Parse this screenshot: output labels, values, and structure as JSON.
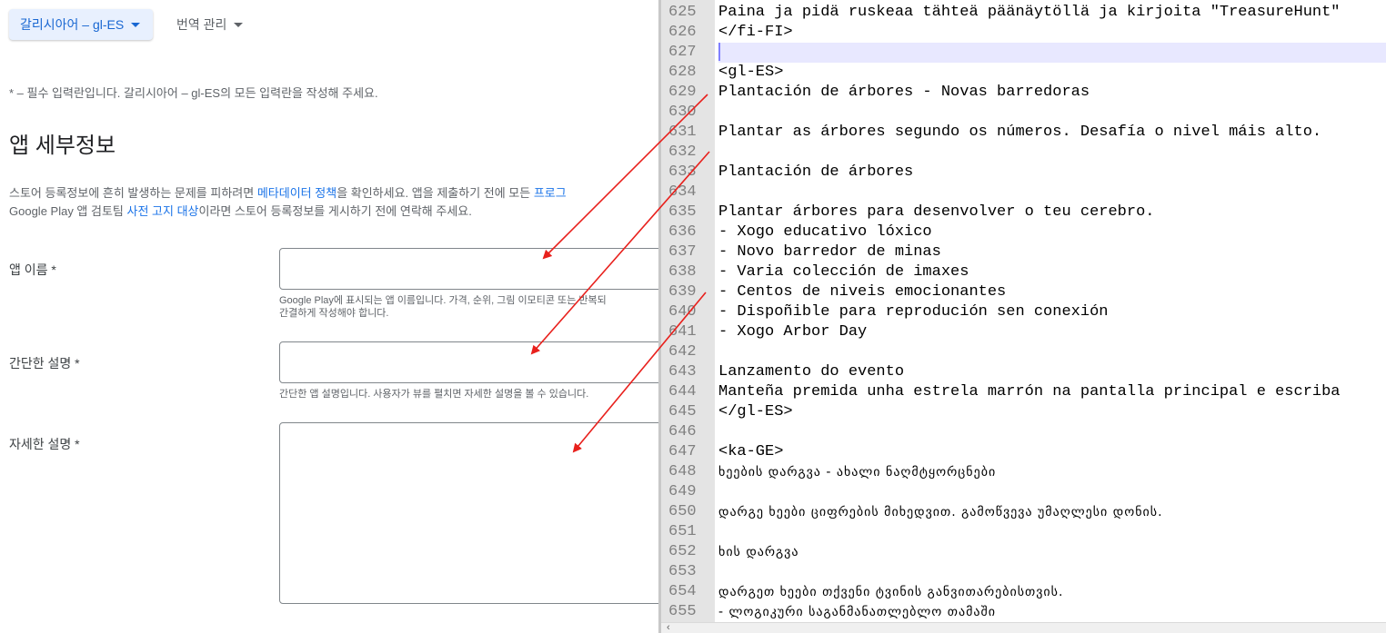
{
  "header": {
    "language_chip": "갈리시아어 – gl-ES",
    "translation_menu": "번역 관리"
  },
  "required_note": "* – 필수 입력란입니다. 갈리시아어 – gl-ES의 모든 입력란을 작성해 주세요.",
  "section_title": "앱 세부정보",
  "policy": {
    "line1_pre": "스토어 등록정보에 흔히 발생하는 문제를 피하려면 ",
    "line1_link1": "메타데이터 정책",
    "line1_mid": "을 확인하세요. 앱을 제출하기 전에 모든 ",
    "line1_link2": "프로그",
    "line2_pre": "Google Play 앱 검토팀 ",
    "line2_link": "사전 고지 대상",
    "line2_post": "이라면 스토어 등록정보를 게시하기 전에 연락해 주세요."
  },
  "fields": {
    "app_name": {
      "label": "앱 이름 *",
      "value": "",
      "help_line1": "Google Play에 표시되는 앱 이름입니다. 가격, 순위, 그림 이모티콘 또는 반복되",
      "help_line2": "간결하게 작성해야 합니다."
    },
    "short_desc": {
      "label": "간단한 설명 *",
      "value": "",
      "help_line1": "간단한 앱 설명입니다. 사용자가 뷰를 펼치면 자세한 설명을 볼 수 있습니다."
    },
    "full_desc": {
      "label": "자세한 설명 *",
      "value": ""
    }
  },
  "editor": {
    "lines": [
      {
        "n": "625",
        "text": "Paina ja pidä ruskeaa tähteä päänäytöllä ja kirjoita \"TreasureHunt\""
      },
      {
        "n": "626",
        "text": "</fi-FI>"
      },
      {
        "n": "627",
        "text": ""
      },
      {
        "n": "628",
        "text": "<gl-ES>"
      },
      {
        "n": "629",
        "text": "Plantación de árbores - Novas barredoras"
      },
      {
        "n": "630",
        "text": ""
      },
      {
        "n": "631",
        "text": "Plantar as árbores segundo os números. Desafía o nivel máis alto."
      },
      {
        "n": "632",
        "text": ""
      },
      {
        "n": "633",
        "text": "Plantación de árbores"
      },
      {
        "n": "634",
        "text": ""
      },
      {
        "n": "635",
        "text": "Plantar árbores para desenvolver o teu cerebro."
      },
      {
        "n": "636",
        "text": "- Xogo educativo lóxico"
      },
      {
        "n": "637",
        "text": "- Novo barredor de minas"
      },
      {
        "n": "638",
        "text": "- Varia colección de imaxes"
      },
      {
        "n": "639",
        "text": "- Centos de niveis emocionantes"
      },
      {
        "n": "640",
        "text": "- Dispoñible para reprodución sen conexión"
      },
      {
        "n": "641",
        "text": "- Xogo Arbor Day"
      },
      {
        "n": "642",
        "text": ""
      },
      {
        "n": "643",
        "text": "Lanzamento do evento"
      },
      {
        "n": "644",
        "text": "Manteña premida unha estrela marrón na pantalla principal e escriba"
      },
      {
        "n": "645",
        "text": "</gl-ES>"
      },
      {
        "n": "646",
        "text": ""
      },
      {
        "n": "647",
        "text": "<ka-GE>"
      },
      {
        "n": "648",
        "text": "ხეების დარგვა - ახალი ნაღმტყორცნები"
      },
      {
        "n": "649",
        "text": ""
      },
      {
        "n": "650",
        "text": "დარგე ხეები ციფრების მიხედვით. გამოწვევა უმაღლესი დონის."
      },
      {
        "n": "651",
        "text": ""
      },
      {
        "n": "652",
        "text": "ხის დარგვა"
      },
      {
        "n": "653",
        "text": ""
      },
      {
        "n": "654",
        "text": "დარგეთ ხეები თქვენი ტვინის განვითარებისთვის."
      },
      {
        "n": "655",
        "text": "- ლოგიკური საგანმანათლებლო თამაში"
      }
    ],
    "scroll_left_arrow": "‹"
  },
  "colors": {
    "accent": "#1a73e8",
    "chip_bg": "#e8f0fe",
    "annotation_arrow": "#e8201c",
    "gutter_bg": "#e4e4e4",
    "current_line": "#e8e8ff"
  }
}
